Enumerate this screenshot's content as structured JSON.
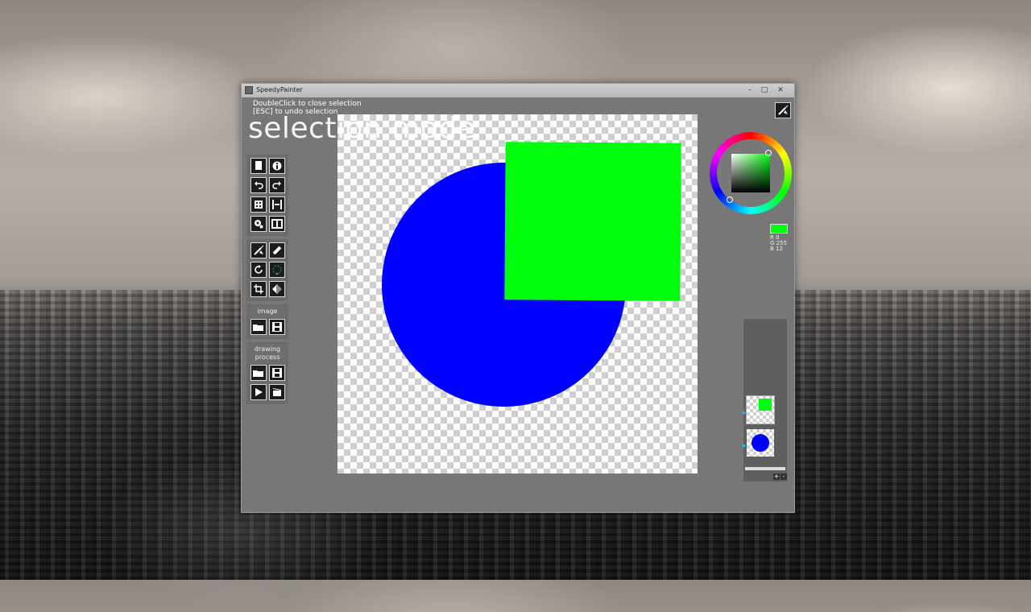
{
  "window": {
    "title": "SpeedyPainter",
    "controls": [
      "–",
      "□",
      "✕"
    ]
  },
  "hints": {
    "line1": "DoubleClick to close selection",
    "line2": "[ESC] to undo selection"
  },
  "mode_label": "selection mode",
  "toolbar": {
    "image_label": "image",
    "drawing_label_1": "drawing",
    "drawing_label_2": "process"
  },
  "icons": [
    "new-document-icon",
    "info-icon",
    "undo-icon",
    "redo-icon",
    "random-icon",
    "mirror-icon",
    "settings-icon",
    "presentation-icon",
    "brush-icon",
    "eraser-icon",
    "rotate-icon",
    "lasso-icon",
    "crop-icon",
    "flip-icon",
    "folder-open-icon",
    "save-icon",
    "play-icon",
    "clapperboard-icon"
  ],
  "color": {
    "current_hex": "#00ff0c",
    "r_label": "R",
    "r_value": "0",
    "g_label": "G",
    "g_value": "255",
    "b_label": "B",
    "b_value": "12"
  },
  "canvas": {
    "shapes": [
      {
        "type": "circle",
        "color": "#0000ff"
      },
      {
        "type": "square",
        "color": "#00ff0c"
      }
    ]
  },
  "layers": {
    "add_label": "+",
    "remove_label": "-"
  }
}
